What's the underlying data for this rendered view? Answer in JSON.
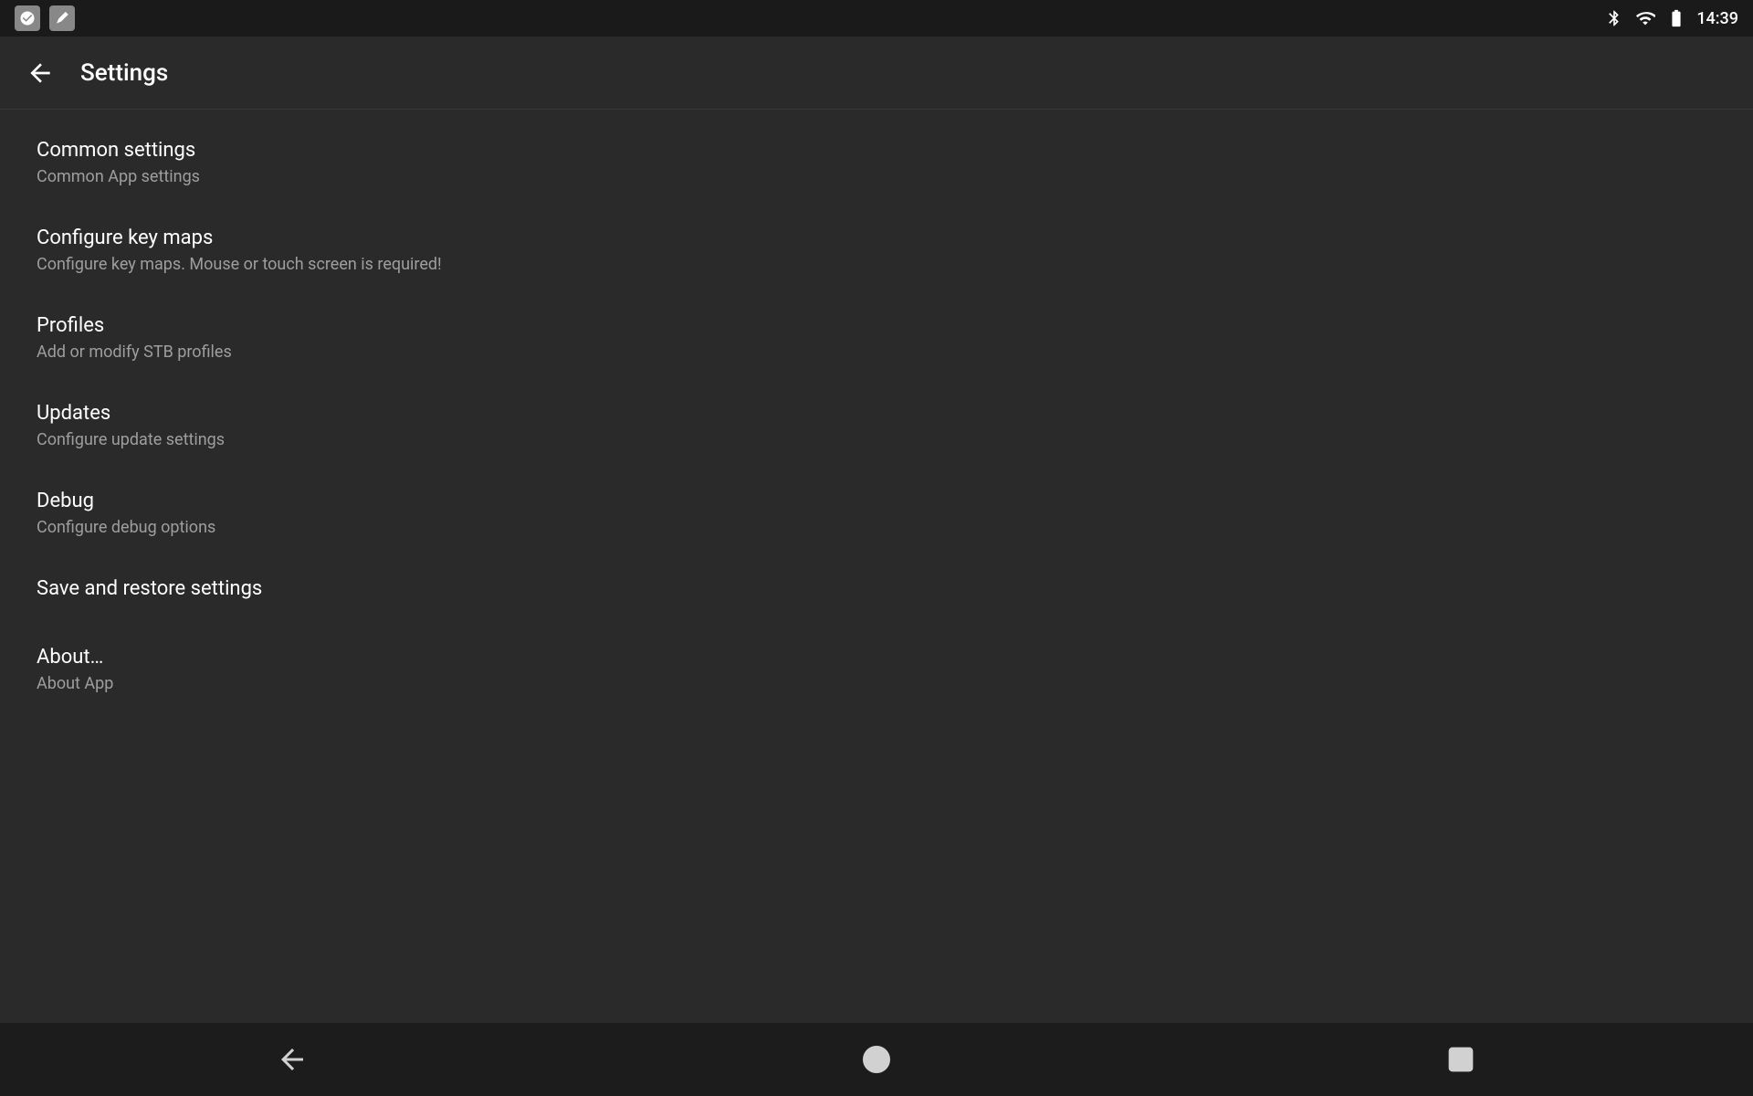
{
  "statusBar": {
    "time": "14:39",
    "icons": {
      "bluetooth": "bluetooth-icon",
      "wifi": "wifi-icon",
      "battery": "battery-icon"
    }
  },
  "toolbar": {
    "backLabel": "←",
    "title": "Settings"
  },
  "settingsItems": [
    {
      "id": "common-settings",
      "title": "Common settings",
      "subtitle": "Common App settings"
    },
    {
      "id": "configure-key-maps",
      "title": "Configure key maps",
      "subtitle": "Configure key maps. Mouse or touch screen is required!"
    },
    {
      "id": "profiles",
      "title": "Profiles",
      "subtitle": "Add or modify STB profiles"
    },
    {
      "id": "updates",
      "title": "Updates",
      "subtitle": "Configure update settings"
    },
    {
      "id": "debug",
      "title": "Debug",
      "subtitle": "Configure debug options"
    },
    {
      "id": "save-restore",
      "title": "Save and restore settings",
      "subtitle": ""
    },
    {
      "id": "about",
      "title": "About…",
      "subtitle": "About App"
    }
  ],
  "navBar": {
    "back": "back-nav-icon",
    "home": "home-nav-icon",
    "recents": "recents-nav-icon"
  }
}
